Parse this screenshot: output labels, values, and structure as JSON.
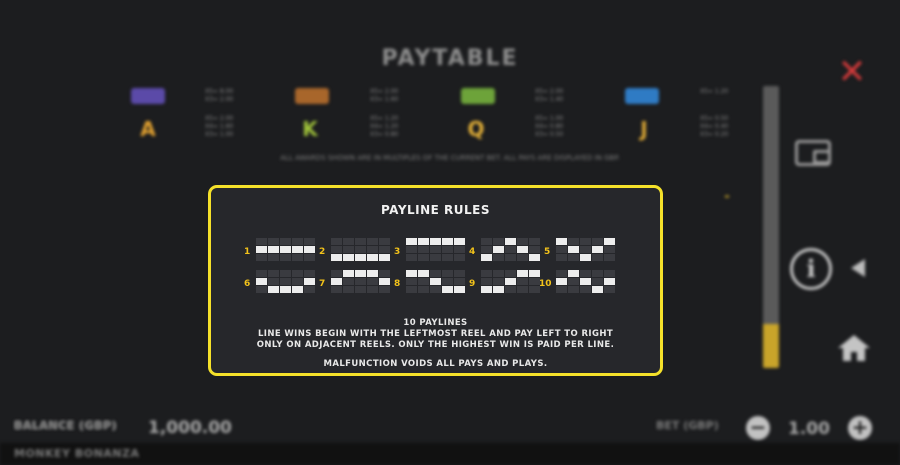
{
  "background": {
    "title": "PAYTABLE",
    "symbol_colors": [
      "#5b4aa8",
      "#a8662b",
      "#6da33a",
      "#2f7bc4"
    ],
    "letter_symbols": [
      "A",
      "K",
      "Q",
      "J"
    ],
    "pay_columns_top": [
      "X5= 8.00\nX3= 2.00",
      "X5= 2.00\nX3= 1.60",
      "X5= 2.00\nX3= 1.40",
      "X5= 1.20"
    ],
    "pay_columns_bottom": [
      "X5= 2.00\nX4= 1.60\nX3= 1.00",
      "X5= 1.20\nX4= 1.20\nX3= 0.80",
      "X5= 1.00\nX4= 0.80\nX3= 0.50",
      "X5= 0.50\nX4= 0.40\nX3= 0.20"
    ],
    "disclaimer": "ALL AWARDS SHOWN ARE IN MULTIPLES OF THE CURRENT BET. ALL PAYS ARE DISPLAYED IN GBP."
  },
  "modal": {
    "title": "PAYLINE RULES",
    "paylines": [
      {
        "number": "1",
        "rows": [
          1,
          1,
          1,
          1,
          1
        ]
      },
      {
        "number": "2",
        "rows": [
          2,
          2,
          2,
          2,
          2
        ]
      },
      {
        "number": "3",
        "rows": [
          0,
          0,
          0,
          0,
          0
        ]
      },
      {
        "number": "4",
        "rows": [
          2,
          1,
          0,
          1,
          2
        ]
      },
      {
        "number": "5",
        "rows": [
          0,
          1,
          2,
          1,
          0
        ]
      },
      {
        "number": "6",
        "rows": [
          1,
          2,
          2,
          2,
          1
        ]
      },
      {
        "number": "7",
        "rows": [
          1,
          0,
          0,
          0,
          1
        ]
      },
      {
        "number": "8",
        "rows": [
          0,
          0,
          1,
          2,
          2
        ]
      },
      {
        "number": "9",
        "rows": [
          2,
          2,
          1,
          0,
          0
        ]
      },
      {
        "number": "10",
        "rows": [
          1,
          0,
          1,
          2,
          1
        ]
      }
    ],
    "count_text": "10 PAYLINES",
    "rules_line1": "LINE WINS BEGIN WITH THE LEFTMOST REEL AND PAY LEFT TO RIGHT",
    "rules_line2": "ONLY ON ADJACENT REELS. ONLY THE HIGHEST WIN IS PAID PER LINE.",
    "malfunction_text": "MALFUNCTION VOIDS ALL PAYS AND PLAYS."
  },
  "controls": {
    "close_icon": "close-x-icon",
    "wallet_icon": "wallet-icon",
    "info_icon": "info-icon",
    "info_glyph": "i",
    "arrow_icon": "arrow-left-icon",
    "home_icon": "home-icon",
    "scroll_position": 0.85
  },
  "footer": {
    "balance_label": "BALANCE (GBP)",
    "balance_value": "1,000.00",
    "bet_label": "BET (GBP)",
    "bet_value": "1.00",
    "minus": "−",
    "plus": "+",
    "game_name": "MONKEY BONANZA"
  },
  "colors": {
    "highlight": "#f5e12a",
    "payline_number": "#f2c21a",
    "close": "#d23a3a"
  }
}
